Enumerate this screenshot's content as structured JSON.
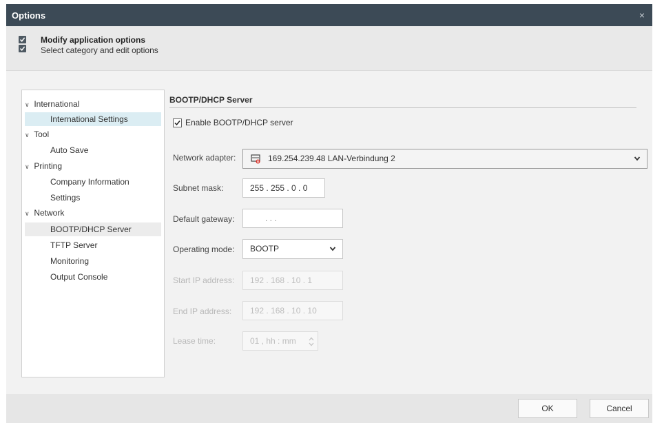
{
  "window": {
    "title": "Options",
    "close_glyph": "×"
  },
  "header": {
    "title": "Modify application options",
    "subtitle": "Select category and edit options",
    "icon": "checkbox-icon"
  },
  "tree": {
    "items": [
      {
        "label": "International",
        "expandable": true
      },
      {
        "label": "International Settings",
        "selected": true
      },
      {
        "label": "Tool",
        "expandable": true
      },
      {
        "label": "Auto Save"
      },
      {
        "label": "Printing",
        "expandable": true
      },
      {
        "label": "Company Information"
      },
      {
        "label": "Settings"
      },
      {
        "label": "Network",
        "expandable": true
      },
      {
        "label": "BOOTP/DHCP Server",
        "active": true
      },
      {
        "label": "TFTP Server"
      },
      {
        "label": "Monitoring"
      },
      {
        "label": "Output Console"
      }
    ]
  },
  "section": {
    "title": "BOOTP/DHCP Server",
    "enable": {
      "label": "Enable BOOTP/DHCP server",
      "checked": true
    },
    "network_adapter": {
      "label": "Network adapter:",
      "value": "169.254.239.48  LAN-Verbindung 2",
      "icon": "network-adapter-icon"
    },
    "subnet_mask": {
      "label": "Subnet mask:",
      "value": "255 . 255 .  0  .  0"
    },
    "default_gateway": {
      "label": "Default gateway:",
      "value": ".    .    ."
    },
    "operating_mode": {
      "label": "Operating mode:",
      "value": "BOOTP"
    },
    "start_ip": {
      "label": "Start IP address:",
      "value": "192 . 168 . 10 .  1"
    },
    "end_ip": {
      "label": "End IP address:",
      "value": "192 . 168 . 10 . 10"
    },
    "lease_time": {
      "label": "Lease time:",
      "value": "01 , hh : mm"
    }
  },
  "buttons": {
    "ok": "OK",
    "cancel": "Cancel"
  },
  "colors": {
    "titlebar": "#3c4a56",
    "selected_tree": "#dbedf3",
    "dialog_bg": "#f2f2f2"
  }
}
